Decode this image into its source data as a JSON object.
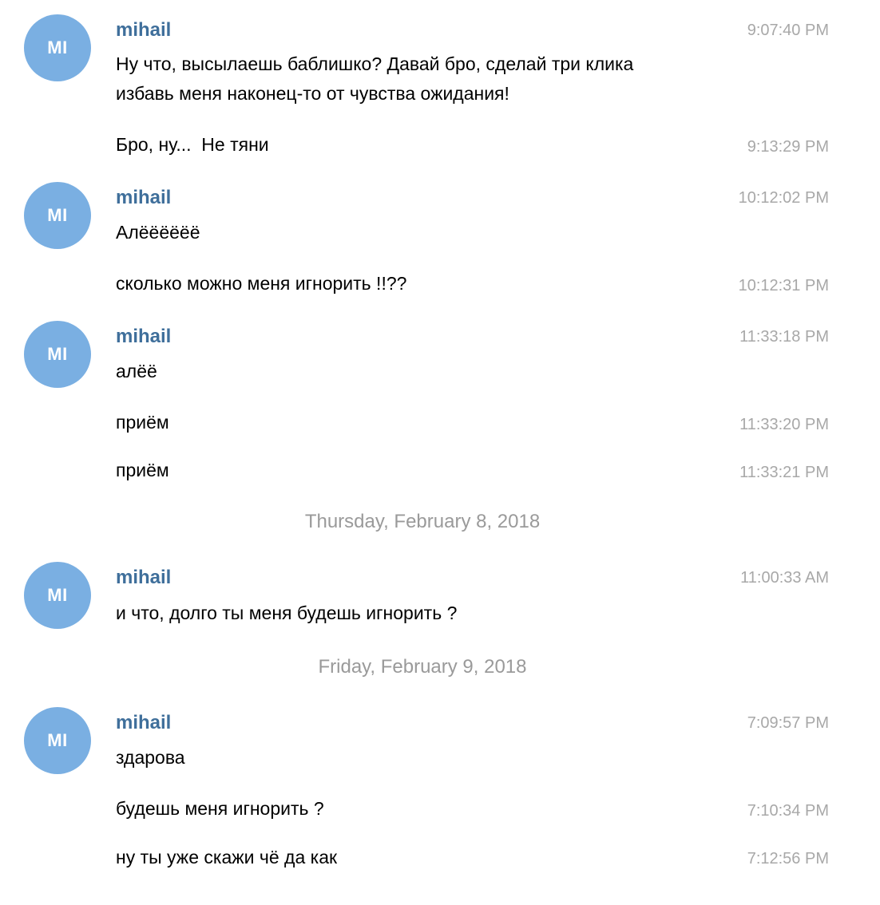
{
  "avatar_color": "#7aafe2",
  "name_color": "#3f6f9b",
  "groups": [
    {
      "avatar": "MI",
      "sender": "mihail",
      "messages": [
        {
          "text": "Ну что, высылаешь баблишко? Давай бро, сделай три клика\nизбавь меня наконец-то от чувства ожидания!",
          "time": "9:07:40 PM"
        },
        {
          "text": "Бро, ну...  Не тяни",
          "time": "9:13:29 PM"
        }
      ]
    },
    {
      "avatar": "MI",
      "sender": "mihail",
      "messages": [
        {
          "text": "Алёёёёёё",
          "time": "10:12:02 PM"
        },
        {
          "text": "сколько можно меня игнорить !!??",
          "time": "10:12:31 PM"
        }
      ]
    },
    {
      "avatar": "MI",
      "sender": "mihail",
      "messages": [
        {
          "text": "алёё",
          "time": "11:33:18 PM"
        },
        {
          "text": "приём",
          "time": "11:33:20 PM"
        },
        {
          "text": "приём",
          "time": "11:33:21 PM"
        }
      ]
    },
    {
      "avatar": "MI",
      "sender": "mihail",
      "messages": [
        {
          "text": "и что, долго ты меня будешь игнорить ?",
          "time": "11:00:33 AM"
        }
      ]
    },
    {
      "avatar": "MI",
      "sender": "mihail",
      "messages": [
        {
          "text": "здарова",
          "time": "7:09:57 PM"
        },
        {
          "text": "будешь меня игнорить ?",
          "time": "7:10:34 PM"
        },
        {
          "text": "ну ты уже скажи чё да как",
          "time": "7:12:56 PM"
        }
      ]
    }
  ],
  "date_separators": [
    "Thursday, February 8, 2018",
    "Friday, February 9, 2018"
  ]
}
